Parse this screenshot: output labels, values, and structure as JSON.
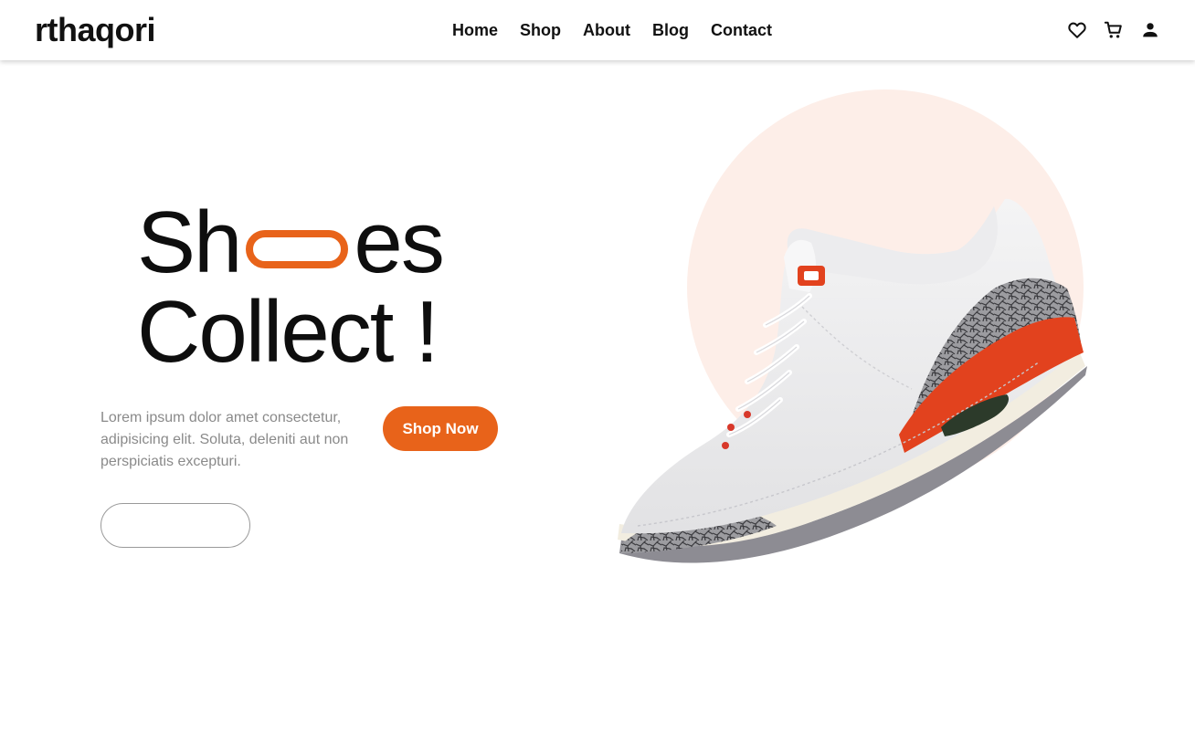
{
  "header": {
    "logo": "rthaqori",
    "nav": [
      "Home",
      "Shop",
      "About",
      "Blog",
      "Contact"
    ],
    "icons": [
      "heart-icon",
      "cart-icon",
      "user-icon"
    ]
  },
  "hero": {
    "title_line1_pre": "Sh",
    "title_line1_post": "es",
    "title_line2": "Collect !",
    "description": "Lorem ipsum dolor amet consectetur, adipisicing elit. Soluta, deleniti aut non perspiciatis excepturi.",
    "cta_label": "Shop Now",
    "image": "sneaker-image"
  },
  "colors": {
    "accent": "#e8631a",
    "circle": "#fdeee8",
    "text": "#111111",
    "muted": "#8a8a8a"
  }
}
